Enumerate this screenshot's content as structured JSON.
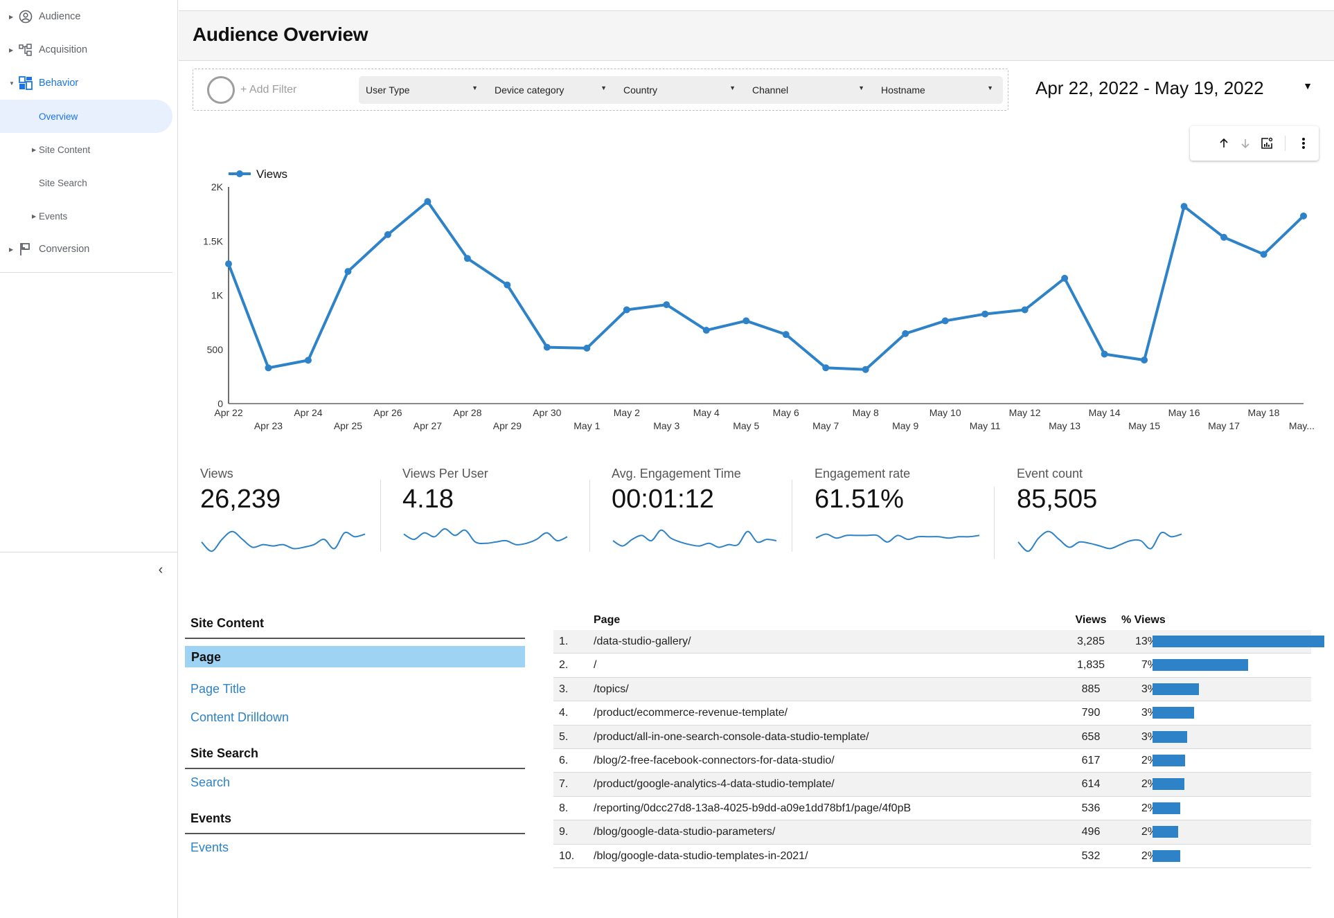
{
  "sidebar": {
    "items": [
      {
        "label": "Audience",
        "icon": "account-circle-icon",
        "expanded": false
      },
      {
        "label": "Acquisition",
        "icon": "hierarchy-icon",
        "expanded": false
      },
      {
        "label": "Behavior",
        "icon": "dashboard-icon",
        "expanded": true
      },
      {
        "label": "Overview",
        "selected": true
      },
      {
        "label": "Site Content",
        "has_children": true
      },
      {
        "label": "Site Search"
      },
      {
        "label": "Events",
        "has_children": true
      },
      {
        "label": "Conversion",
        "icon": "flag-icon",
        "expanded": false
      }
    ],
    "collapse_icon": "chevron-left-icon"
  },
  "header": {
    "title": "Audience Overview"
  },
  "filters": {
    "add_filter_label": "+ Add Filter",
    "dropdowns": [
      "User Type",
      "Device category",
      "Country",
      "Channel",
      "Hostname"
    ]
  },
  "date_range": {
    "label": "Apr 22, 2022 - May 19, 2022"
  },
  "chart_toolbar": {
    "icons": [
      "arrow-up-icon",
      "arrow-down-icon",
      "chart-settings-icon",
      "more-vert-icon"
    ]
  },
  "colors": {
    "accent": "#1a73e8",
    "series": "#2e82c7",
    "selected_bg": "#9fd3f3"
  },
  "chart_data": {
    "type": "line",
    "title": "",
    "xlabel": "",
    "ylabel": "",
    "legend": {
      "entries": [
        "Views"
      ],
      "position": "top-left"
    },
    "ylim": [
      0,
      2000
    ],
    "y_ticks": [
      0,
      500,
      1000,
      1500,
      2000
    ],
    "y_tick_labels": [
      "0",
      "500",
      "1K",
      "1.5K",
      "2K"
    ],
    "grid": false,
    "categories": [
      "Apr 22",
      "Apr 23",
      "Apr 24",
      "Apr 25",
      "Apr 26",
      "Apr 27",
      "Apr 28",
      "Apr 29",
      "Apr 30",
      "May 1",
      "May 2",
      "May 3",
      "May 4",
      "May 5",
      "May 6",
      "May 7",
      "May 8",
      "May 9",
      "May 10",
      "May 11",
      "May 12",
      "May 13",
      "May 14",
      "May 15",
      "May 16",
      "May 17",
      "May 18",
      "May..."
    ],
    "series": [
      {
        "name": "Views",
        "values": [
          1290,
          330,
          400,
          1220,
          1560,
          1865,
          1340,
          1095,
          520,
          512,
          866,
          913,
          677,
          764,
          638,
          331,
          315,
          646,
          764,
          827,
          866,
          1157,
          457,
          402,
          1820,
          1535,
          1378,
          1732
        ]
      }
    ]
  },
  "scorecards": [
    {
      "title": "Views",
      "value": "26,239",
      "spark": [
        0.45,
        0.1,
        0.55,
        0.85,
        0.55,
        0.25,
        0.35,
        0.3,
        0.35,
        0.2,
        0.25,
        0.35,
        0.55,
        0.2,
        0.8,
        0.65,
        0.75
      ]
    },
    {
      "title": "Views Per User",
      "value": "4.18",
      "spark": [
        0.75,
        0.55,
        0.8,
        0.65,
        0.95,
        0.7,
        0.9,
        0.45,
        0.4,
        0.45,
        0.5,
        0.35,
        0.4,
        0.55,
        0.8,
        0.5,
        0.65
      ]
    },
    {
      "title": "Avg. Engagement Time",
      "value": "00:01:12",
      "spark": [
        0.5,
        0.3,
        0.55,
        0.7,
        0.5,
        0.9,
        0.6,
        0.45,
        0.35,
        0.3,
        0.4,
        0.25,
        0.35,
        0.35,
        0.85,
        0.45,
        0.55,
        0.5
      ]
    },
    {
      "title": "Engagement rate",
      "value": "61.51%",
      "spark": [
        0.6,
        0.75,
        0.6,
        0.7,
        0.7,
        0.7,
        0.7,
        0.45,
        0.7,
        0.55,
        0.65,
        0.65,
        0.65,
        0.6,
        0.65,
        0.65,
        0.7
      ]
    },
    {
      "title": "Event count",
      "value": "85,505",
      "spark": [
        0.45,
        0.1,
        0.6,
        0.85,
        0.55,
        0.25,
        0.45,
        0.4,
        0.3,
        0.2,
        0.35,
        0.5,
        0.5,
        0.2,
        0.8,
        0.65,
        0.75
      ]
    }
  ],
  "content_nav": {
    "sections": [
      {
        "title": "Site Content",
        "links": [
          "Page",
          "Page Title",
          "Content Drilldown"
        ],
        "selected": "Page"
      },
      {
        "title": "Site Search",
        "links": [
          "Search"
        ]
      },
      {
        "title": "Events",
        "links": [
          "Events"
        ]
      }
    ]
  },
  "table": {
    "headers": {
      "page": "Page",
      "views": "Views",
      "pct": "% Views"
    },
    "rows": [
      {
        "num": "1.",
        "page": "/data-studio-gallery/",
        "views": "3,285",
        "pct": "13%",
        "share": 0.1252
      },
      {
        "num": "2.",
        "page": "/",
        "views": "1,835",
        "pct": "7%",
        "share": 0.0699
      },
      {
        "num": "3.",
        "page": "/topics/",
        "views": "885",
        "pct": "3%",
        "share": 0.0337
      },
      {
        "num": "4.",
        "page": "/product/ecommerce-revenue-template/",
        "views": "790",
        "pct": "3%",
        "share": 0.0301
      },
      {
        "num": "5.",
        "page": "/product/all-in-one-search-console-data-studio-template/",
        "views": "658",
        "pct": "3%",
        "share": 0.0251
      },
      {
        "num": "6.",
        "page": "/blog/2-free-facebook-connectors-for-data-studio/",
        "views": "617",
        "pct": "2%",
        "share": 0.0235
      },
      {
        "num": "7.",
        "page": "/product/google-analytics-4-data-studio-template/",
        "views": "614",
        "pct": "2%",
        "share": 0.0234
      },
      {
        "num": "8.",
        "page": "/reporting/0dcc27d8-13a8-4025-b9dd-a09e1dd78bf1/page/4f0pB",
        "views": "536",
        "pct": "2%",
        "share": 0.0204
      },
      {
        "num": "9.",
        "page": "/blog/google-data-studio-parameters/",
        "views": "496",
        "pct": "2%",
        "share": 0.0189
      },
      {
        "num": "10.",
        "page": "/blog/google-data-studio-templates-in-2021/",
        "views": "532",
        "pct": "2%",
        "share": 0.0203
      }
    ]
  }
}
